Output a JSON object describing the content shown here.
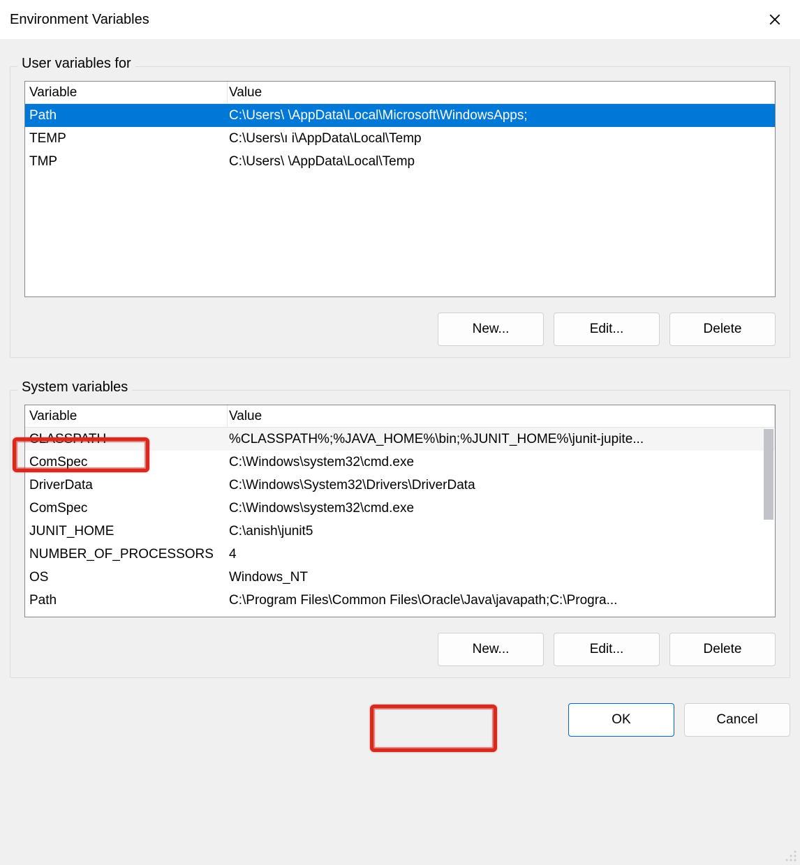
{
  "window": {
    "title": "Environment Variables"
  },
  "groups": {
    "user": {
      "legend": "User variables for"
    },
    "system": {
      "legend": "System variables"
    }
  },
  "columns": {
    "variable": "Variable",
    "value": "Value"
  },
  "userVars": [
    {
      "name": "Path",
      "value": "C:\\Users\\             \\AppData\\Local\\Microsoft\\WindowsApps;",
      "selected": true
    },
    {
      "name": "TEMP",
      "value": "C:\\Users\\ı            i\\AppData\\Local\\Temp"
    },
    {
      "name": "TMP",
      "value": "C:\\Users\\             \\AppData\\Local\\Temp"
    }
  ],
  "systemVars": [
    {
      "name": "CLASSPATH",
      "value": "%CLASSPATH%;%JAVA_HOME%\\bin;%JUNIT_HOME%\\junit-jupite...",
      "shaded": true
    },
    {
      "name": "ComSpec",
      "value": "C:\\Windows\\system32\\cmd.exe"
    },
    {
      "name": "DriverData",
      "value": "C:\\Windows\\System32\\Drivers\\DriverData"
    },
    {
      "name": "ComSpec",
      "value": "C:\\Windows\\system32\\cmd.exe"
    },
    {
      "name": "JUNIT_HOME",
      "value": "C:\\anish\\junit5"
    },
    {
      "name": "NUMBER_OF_PROCESSORS",
      "value": "4"
    },
    {
      "name": "OS",
      "value": "Windows_NT"
    },
    {
      "name": "Path",
      "value": "C:\\Program Files\\Common Files\\Oracle\\Java\\javapath;C:\\Progra..."
    }
  ],
  "buttons": {
    "new": "New...",
    "edit": "Edit...",
    "delete": "Delete",
    "ok": "OK",
    "cancel": "Cancel"
  }
}
